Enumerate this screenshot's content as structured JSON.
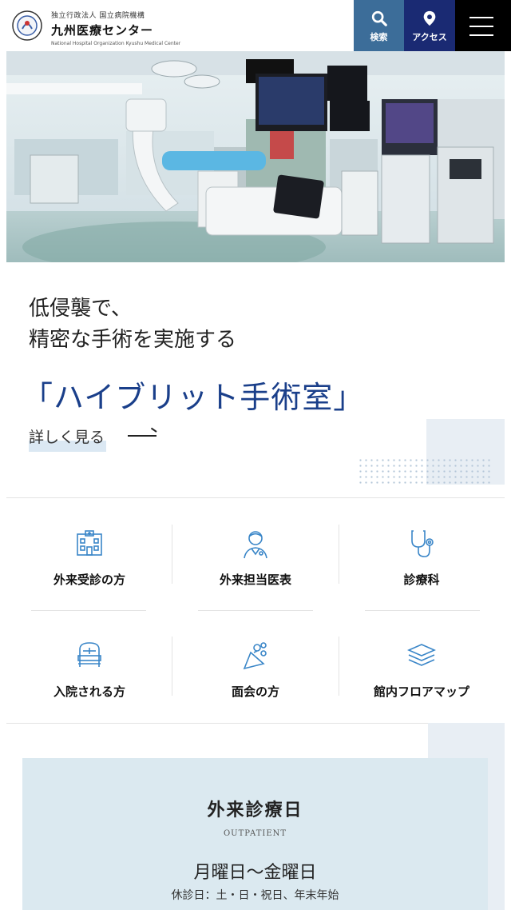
{
  "header": {
    "logo_sub": "独立行政法人 国立病院機構",
    "logo_name": "九州医療センター",
    "logo_en": "National Hospital Organization Kyushu Medical Center",
    "search_label": "検索",
    "access_label": "アクセス",
    "colors": {
      "search": "#3c6d99",
      "access": "#1a2a73",
      "menu": "#000000"
    }
  },
  "feature": {
    "line1": "低侵襲で、",
    "line2": "精密な手術を実施する",
    "title": "「ハイブリット手術室」",
    "more": "詳しく見る"
  },
  "nav": [
    {
      "label": "外来受診の方",
      "icon": "hospital-building-icon"
    },
    {
      "label": "外来担当医表",
      "icon": "doctor-icon"
    },
    {
      "label": "診療科",
      "icon": "stethoscope-icon"
    },
    {
      "label": "入院される方",
      "icon": "hospital-bed-icon"
    },
    {
      "label": "面会の方",
      "icon": "flower-bouquet-icon"
    },
    {
      "label": "館内フロアマップ",
      "icon": "layers-map-icon"
    }
  ],
  "outpatient": {
    "title": "外来診療日",
    "subtitle": "OUTPATIENT",
    "days": "月曜日～金曜日",
    "closed": "休診日：土・日・祝日、年末年始"
  }
}
